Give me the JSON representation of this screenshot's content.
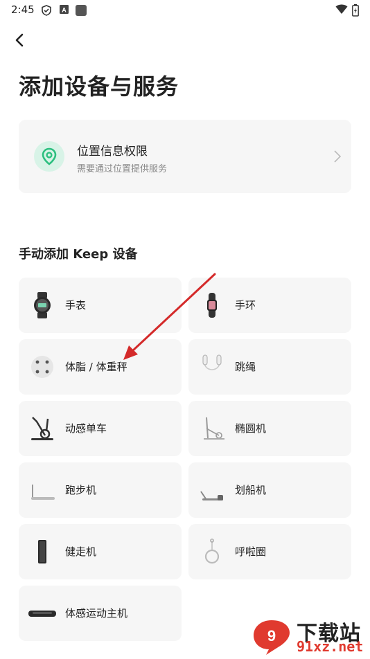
{
  "status_bar": {
    "time": "2:45",
    "status_icons": [
      "shield-check-icon",
      "a-badge-icon",
      "square-icon"
    ],
    "right_icons": [
      "wifi-icon",
      "battery-charging-icon"
    ]
  },
  "nav": {
    "back_icon": "chevron-left-icon"
  },
  "page": {
    "title": "添加设备与服务"
  },
  "permission_card": {
    "icon": "location-pin-icon",
    "title": "位置信息权限",
    "subtitle": "需要通过位置提供服务",
    "chevron": "chevron-right-icon",
    "accent": "#2bbf7f"
  },
  "section": {
    "title": "手动添加 Keep 设备"
  },
  "devices": [
    {
      "label": "手表",
      "icon": "watch-icon"
    },
    {
      "label": "手环",
      "icon": "band-icon"
    },
    {
      "label": "体脂 / 体重秤",
      "icon": "scale-icon"
    },
    {
      "label": "跳绳",
      "icon": "jump-rope-icon"
    },
    {
      "label": "动感单车",
      "icon": "spin-bike-icon"
    },
    {
      "label": "椭圆机",
      "icon": "elliptical-icon"
    },
    {
      "label": "跑步机",
      "icon": "treadmill-icon"
    },
    {
      "label": "划船机",
      "icon": "rowing-machine-icon"
    },
    {
      "label": "健走机",
      "icon": "walking-pad-icon"
    },
    {
      "label": "呼啦圈",
      "icon": "hula-hoop-icon"
    },
    {
      "label": "体感运动主机",
      "icon": "motion-console-icon"
    }
  ],
  "annotation": {
    "arrow_color": "#d42a2a"
  },
  "watermark": {
    "brand_cn": "下载站",
    "brand_url": "91xz.net"
  }
}
